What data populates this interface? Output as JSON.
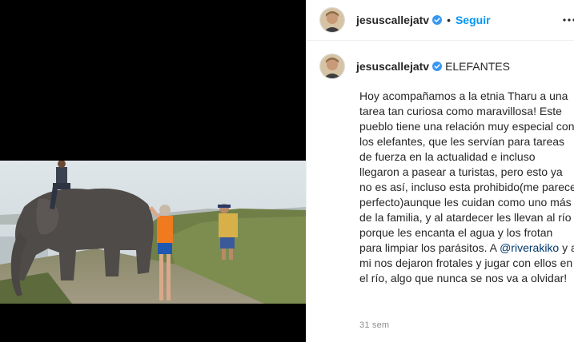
{
  "media": {
    "photo_alt": ""
  },
  "header": {
    "username": "jesuscallejatv",
    "separator": "•",
    "follow_label": "Seguir",
    "more_icon": "more-options-icon"
  },
  "caption": {
    "username": "jesuscallejatv",
    "title": "ELEFANTES",
    "body_part1": "Hoy acompañamos a la etnia Tharu a una tarea tan curiosa como maravillosa! Este pueblo tiene una relación muy especial con los elefantes, que les servían para tareas de fuerza en la actualidad e incluso llegaron a pasear a turistas, pero esto ya no es así, incluso esta prohibido(me parece perfecto)aunque les cuidan como uno más de la familia, y al atardecer les llevan al río porque les encanta el agua y los frotan para limpiar los parásitos. A ",
    "mention": "@riverakiko",
    "body_part2": " y a mi nos dejaron frotales y jugar con ellos en el río, algo que nunca se nos va a olvidar!",
    "timestamp": "31 sem"
  },
  "colors": {
    "accent": "#0095f6",
    "verified": "#3897f0",
    "mention": "#00376b",
    "muted": "#8e8e8e"
  }
}
